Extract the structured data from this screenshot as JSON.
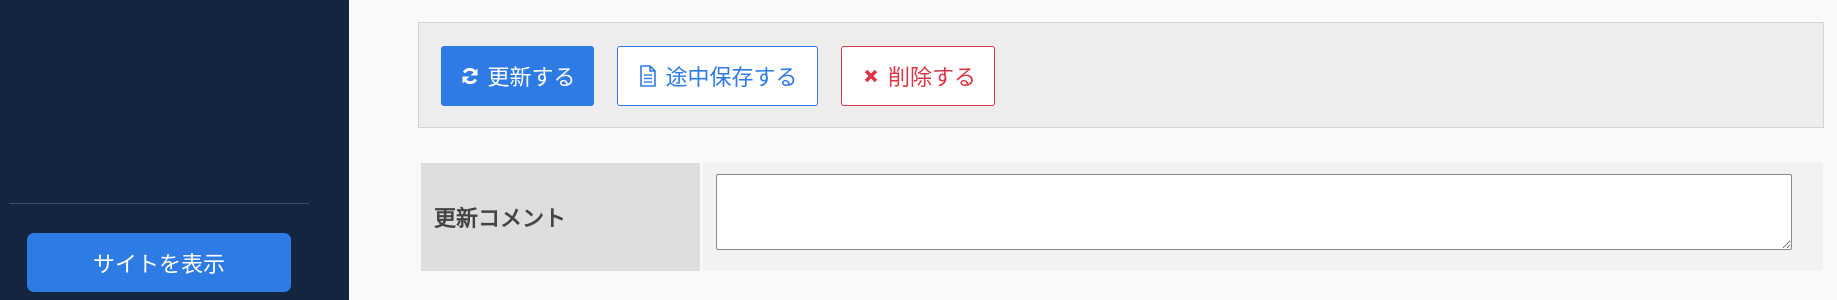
{
  "sidebar": {
    "view_site_label": "サイトを表示"
  },
  "toolbar": {
    "update_label": "更新する",
    "draft_label": "途中保存する",
    "delete_label": "削除する"
  },
  "form": {
    "comment_label": "更新コメント",
    "comment_value": "",
    "comment_placeholder": ""
  },
  "colors": {
    "sidebar_bg": "#14253f",
    "primary": "#2e7be6",
    "danger": "#dc3545"
  },
  "icons": {
    "update": "refresh-icon",
    "draft": "document-icon",
    "delete": "close-icon"
  }
}
